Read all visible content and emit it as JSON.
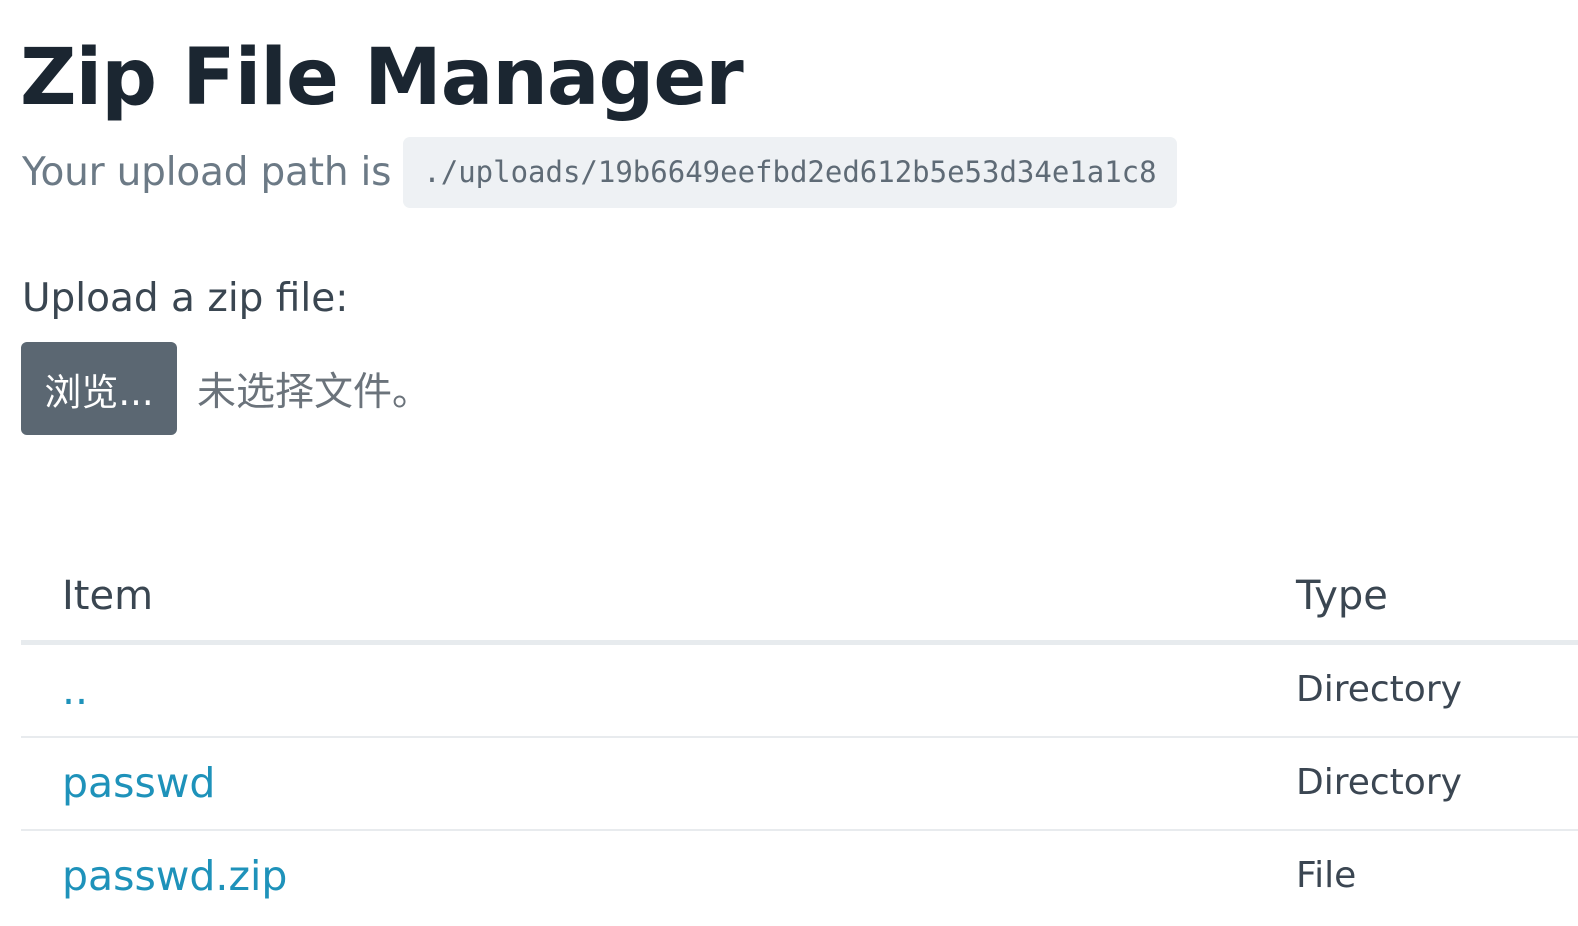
{
  "header": {
    "title": "Zip File Manager"
  },
  "upload_path": {
    "label": "Your upload path is",
    "path": "./uploads/19b6649eefbd2ed612b5e53d34e1a1c8"
  },
  "upload_form": {
    "label": "Upload a zip file:",
    "browse_button_label": "浏览...",
    "no_file_text": "未选择文件。"
  },
  "table": {
    "columns": [
      "Item",
      "Type"
    ],
    "rows": [
      {
        "item": "..",
        "type": "Directory"
      },
      {
        "item": "passwd",
        "type": "Directory"
      },
      {
        "item": "passwd.zip",
        "type": "File"
      }
    ]
  },
  "colors": {
    "link": "#1e92ba",
    "button_bg": "#5b6772",
    "code_bg": "#eef1f4",
    "title": "#1b2631"
  }
}
